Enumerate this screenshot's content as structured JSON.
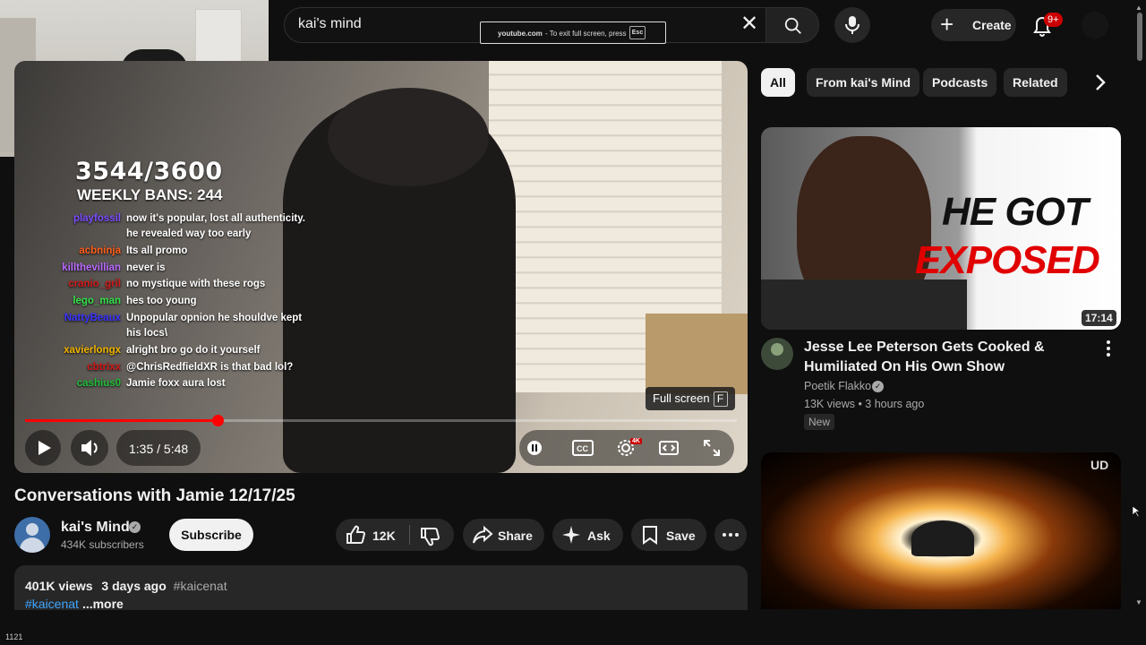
{
  "search": {
    "query": "kai's mind"
  },
  "fullscreen_toast": {
    "site": "youtube.com",
    "message": "- To exit full screen, press",
    "key": "Esc"
  },
  "header": {
    "create_label": "Create",
    "notifications_badge": "9+"
  },
  "stream_overlay": {
    "counter": "3544/3600",
    "weekly_bans": "WEEKLY BANS: 244",
    "chat": [
      {
        "user": "playfossil",
        "color": "#7c4dff",
        "text": "now it's popular, lost all authenticity.",
        "cont": "he revealed way too early"
      },
      {
        "user": "acbninja",
        "color": "#ff5e1a",
        "text": "Its all promo"
      },
      {
        "user": "killthevillian",
        "color": "#b86bff",
        "text": "never is"
      },
      {
        "user": "cranio_gril",
        "color": "#d11a1a",
        "text": "no mystique with these rogs"
      },
      {
        "user": "lego_man",
        "color": "#35e04a",
        "text": "hes too young"
      },
      {
        "user": "NattyBeaux",
        "color": "#3a34ff",
        "text": "Unpopular opnion he shouldve kept",
        "cont": "his locs\\"
      },
      {
        "user": "xavierlongx",
        "color": "#f0b400",
        "text": "alright bro go do it yourself"
      },
      {
        "user": "cbtrixx",
        "color": "#d11a1a",
        "text": "@ChrisRedfieldXR is that bad lol?"
      },
      {
        "user": "cashius0",
        "color": "#1fbf3a",
        "text": "Jamie foxx aura lost"
      }
    ]
  },
  "player": {
    "time": "1:35 / 5:48",
    "progress_fraction": 0.27,
    "fullscreen_tooltip": "Full screen",
    "fullscreen_key": "F",
    "settings_badge": "4K"
  },
  "video": {
    "title": "Conversations with Jamie 12/17/25",
    "channel": "kai's Mind",
    "subscribers": "434K subscribers",
    "subscribe_label": "Subscribe",
    "likes": "12K",
    "share_label": "Share",
    "ask_label": "Ask",
    "save_label": "Save"
  },
  "description": {
    "views": "401K views",
    "age": "3 days ago",
    "hashtag": "#kaicenat",
    "hashtag2": "#kaicenat",
    "more": "...more"
  },
  "chips": [
    "All",
    "From kai's Mind",
    "Podcasts",
    "Related"
  ],
  "recommendations": [
    {
      "thumb_line1": "HE GOT",
      "thumb_line2": "EXPOSED",
      "duration": "17:14",
      "title": "Jesse Lee Peterson Gets Cooked & Humiliated On His Own Show",
      "channel": "Poetik Flakko",
      "meta": "13K views • 3 hours ago",
      "badge": "New"
    },
    {
      "overlay": "UD"
    }
  ],
  "footer": {
    "text": "1121"
  }
}
